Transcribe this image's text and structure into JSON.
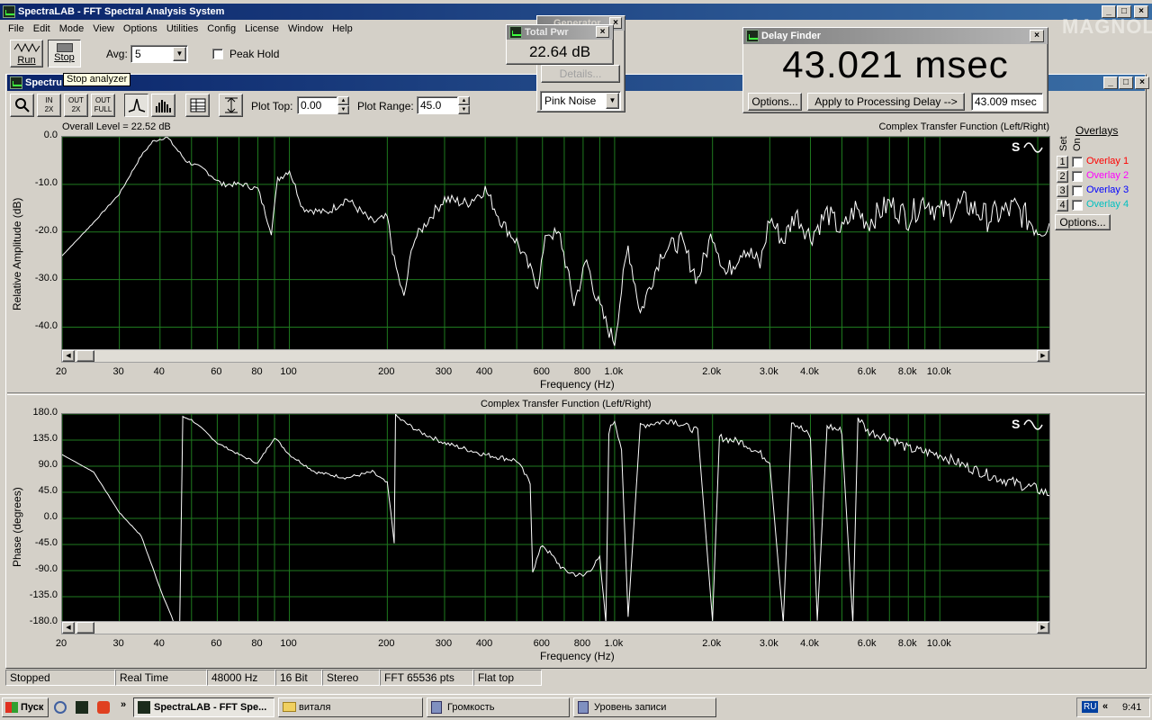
{
  "main_window": {
    "title": "SpectraLAB - FFT Spectral Analysis System"
  },
  "menu": [
    "File",
    "Edit",
    "Mode",
    "View",
    "Options",
    "Utilities",
    "Config",
    "License",
    "Window",
    "Help"
  ],
  "toolbar": {
    "run_label": "Run",
    "stop_label": "Stop",
    "avg_label": "Avg:",
    "avg_value": "5",
    "peak_hold_label": "Peak Hold",
    "tooltip": "Stop analyzer"
  },
  "inner_window": {
    "title": "Spectru"
  },
  "plot_toolbar": {
    "zoom_in_2x": "IN\n2X",
    "zoom_out_2x": "OUT\n2X",
    "zoom_out_full": "OUT\nFULL",
    "plot_top_label": "Plot Top:",
    "plot_top_value": "0.00",
    "plot_range_label": "Plot Range:",
    "plot_range_value": "45.0"
  },
  "generator": {
    "title": "Generator",
    "details_label": "Details...",
    "noise_select": "Pink Noise"
  },
  "total_power": {
    "title": "Total Pwr",
    "value": "22.64 dB"
  },
  "delay_finder": {
    "title": "Delay Finder",
    "value": "43.021 msec",
    "options_label": "Options...",
    "apply_label": "Apply to Processing Delay -->",
    "delay_field": "43.009 msec"
  },
  "watermark": "MAGNOLA",
  "overlays": {
    "title": "Overlays",
    "set_label": "Set",
    "on_label": "On",
    "options_label": "Options...",
    "items": [
      {
        "num": "1",
        "label": "Overlay 1",
        "color": "#ff0000"
      },
      {
        "num": "2",
        "label": "Overlay 2",
        "color": "#ff00ff"
      },
      {
        "num": "3",
        "label": "Overlay 3",
        "color": "#0000ff"
      },
      {
        "num": "4",
        "label": "Overlay 4",
        "color": "#00c0c0"
      }
    ]
  },
  "amp_plot": {
    "overall_level": "Overall Level = 22.52 dB",
    "title": "Complex Transfer Function (Left/Right)",
    "ylabel": "Relative Amplitude (dB)",
    "xlabel": "Frequency (Hz)"
  },
  "phase_plot": {
    "title": "Complex Transfer Function (Left/Right)",
    "ylabel": "Phase (degrees)",
    "xlabel": "Frequency (Hz)"
  },
  "status": [
    "Stopped",
    "Real Time",
    "48000 Hz",
    "16 Bit",
    "Stereo",
    "FFT 65536 pts",
    "Flat top"
  ],
  "taskbar": {
    "start_label": "Пуск",
    "tasks": [
      "SpectraLAB - FFT Spe...",
      "виталя",
      "Громкость",
      "Уровень записи"
    ],
    "lang": "RU",
    "time": "9:41"
  },
  "chart_data": [
    {
      "type": "line",
      "title": "Complex Transfer Function (Left/Right)",
      "xlabel": "Frequency (Hz)",
      "ylabel": "Relative Amplitude (dB)",
      "x_scale": "log",
      "xlim": [
        20,
        22000
      ],
      "ylim": [
        -45,
        0
      ],
      "x_ticks": [
        "20",
        "30",
        "40",
        "60",
        "80",
        "100",
        "200",
        "300",
        "400",
        "600",
        "800",
        "1.0k",
        "2.0k",
        "3.0k",
        "4.0k",
        "6.0k",
        "8.0k",
        "10.0k"
      ],
      "y_ticks": [
        "0.0",
        "-10.0",
        "-20.0",
        "-30.0",
        "-40.0"
      ],
      "grid": true,
      "x": [
        20,
        25,
        30,
        35,
        38,
        42,
        48,
        55,
        62,
        72,
        80,
        88,
        92,
        100,
        110,
        130,
        150,
        180,
        200,
        210,
        225,
        240,
        270,
        300,
        350,
        400,
        450,
        500,
        550,
        580,
        620,
        680,
        750,
        820,
        880,
        950,
        1000,
        1050,
        1100,
        1200,
        1400,
        1600,
        1800,
        2000,
        2200,
        2500,
        2800,
        3000,
        3300,
        3600,
        4000,
        4500,
        5000,
        5500,
        6000,
        7000,
        8000,
        9000,
        10000,
        12000,
        14000,
        17000,
        20000,
        22000
      ],
      "y": [
        -25,
        -18,
        -12,
        -4,
        -1,
        0,
        -5,
        -7,
        -10,
        -10,
        -11,
        -20,
        -9,
        -7,
        -15,
        -16,
        -13,
        -18,
        -17,
        -26,
        -34,
        -22,
        -17,
        -13,
        -14,
        -11,
        -18,
        -22,
        -28,
        -31,
        -20,
        -21,
        -35,
        -26,
        -34,
        -40,
        -43,
        -32,
        -23,
        -37,
        -24,
        -22,
        -30,
        -20,
        -29,
        -23,
        -27,
        -17,
        -22,
        -16,
        -21,
        -16,
        -20,
        -15,
        -18,
        -14,
        -17,
        -13,
        -16,
        -14,
        -17,
        -15,
        -19,
        -18
      ]
    },
    {
      "type": "line",
      "title": "Complex Transfer Function (Left/Right)",
      "xlabel": "Frequency (Hz)",
      "ylabel": "Phase (degrees)",
      "x_scale": "log",
      "xlim": [
        20,
        22000
      ],
      "ylim": [
        -180,
        180
      ],
      "x_ticks": [
        "20",
        "30",
        "40",
        "60",
        "80",
        "100",
        "200",
        "300",
        "400",
        "600",
        "800",
        "1.0k",
        "2.0k",
        "3.0k",
        "4.0k",
        "6.0k",
        "8.0k",
        "10.0k"
      ],
      "y_ticks": [
        "180.0",
        "135.0",
        "90.0",
        "45.0",
        "0.0",
        "-45.0",
        "-90.0",
        "-135.0",
        "-180.0"
      ],
      "grid": true,
      "x": [
        20,
        25,
        30,
        35,
        40,
        44,
        46,
        47,
        50,
        55,
        60,
        70,
        80,
        90,
        100,
        120,
        150,
        180,
        200,
        210,
        212,
        220,
        250,
        300,
        400,
        500,
        550,
        560,
        600,
        700,
        800,
        900,
        940,
        960,
        1000,
        1050,
        1100,
        1200,
        1500,
        1800,
        2000,
        2100,
        2500,
        3000,
        3300,
        3500,
        4000,
        4200,
        4500,
        5000,
        5400,
        5600,
        6000,
        7000,
        8000,
        10000,
        12000,
        15000,
        20000,
        22000
      ],
      "y": [
        110,
        80,
        10,
        -30,
        -120,
        -178,
        -180,
        175,
        170,
        150,
        130,
        110,
        95,
        140,
        110,
        80,
        70,
        80,
        60,
        -40,
        178,
        170,
        150,
        130,
        110,
        100,
        60,
        -90,
        -45,
        -90,
        -100,
        -70,
        -180,
        150,
        170,
        120,
        -175,
        160,
        170,
        150,
        -180,
        140,
        130,
        100,
        -180,
        170,
        140,
        -180,
        160,
        150,
        -180,
        175,
        150,
        140,
        120,
        110,
        90,
        70,
        50,
        40
      ]
    }
  ]
}
